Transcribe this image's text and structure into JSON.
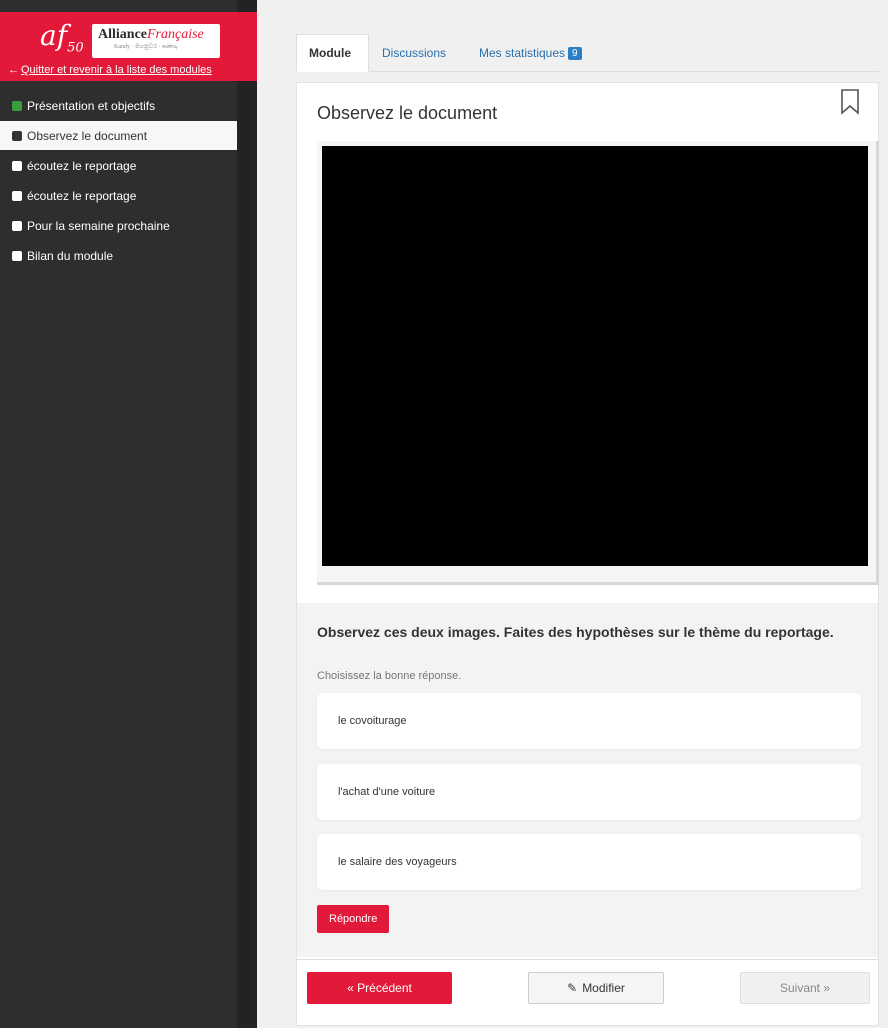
{
  "brand": {
    "logo_af": "af",
    "logo_num": "50",
    "logo_name_a": "Alliance",
    "logo_name_b": "Française",
    "logo_sub": "Kandy · මහනුවර · கண்டி",
    "quit_link": "Quitter et revenir à la liste des modules",
    "color": "#e3193a"
  },
  "sidebar": {
    "items": [
      {
        "label": "Présentation et objectifs",
        "status_color": "#3c9b3c"
      },
      {
        "label": "Observez le document",
        "status_color": "#333333"
      },
      {
        "label": "écoutez le reportage",
        "status_color": "#ffffff"
      },
      {
        "label": "écoutez le reportage",
        "status_color": "#ffffff"
      },
      {
        "label": "Pour la semaine prochaine",
        "status_color": "#ffffff"
      },
      {
        "label": "Bilan du module",
        "status_color": "#ffffff"
      }
    ]
  },
  "tabs": {
    "module": "Module",
    "discussions": "Discussions",
    "stats": "Mes statistiques",
    "stats_badge": "9"
  },
  "content": {
    "title": "Observez le document",
    "question": "Observez ces deux images. Faites des hypothèses sur le thème du reportage.",
    "hint": "Choisissez la bonne réponse.",
    "options": [
      "le covoiturage",
      "l'achat d'une voiture",
      "le salaire des voyageurs"
    ],
    "reply_button": "Répondre"
  },
  "footer": {
    "prev": "« Précédent",
    "edit": "Modifier",
    "next": "Suivant »"
  }
}
